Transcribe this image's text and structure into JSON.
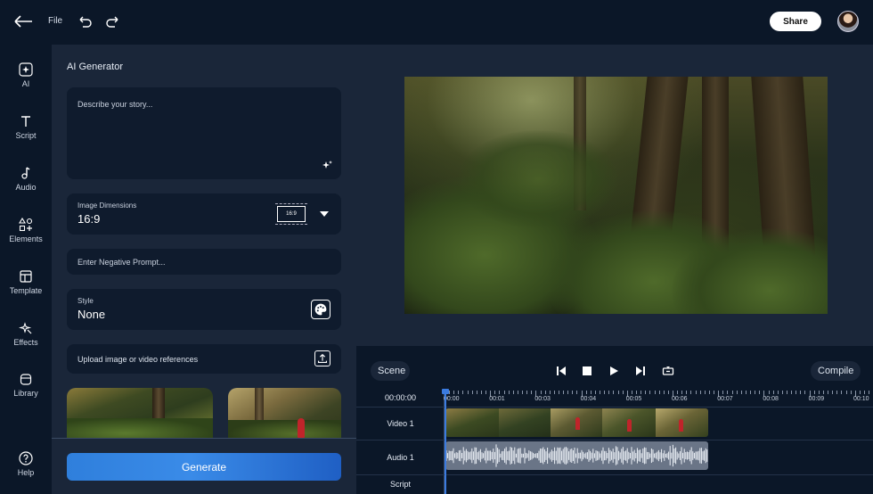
{
  "topbar": {
    "file_label": "File",
    "share_label": "Share"
  },
  "sidebar": {
    "items": [
      {
        "label": "AI",
        "icon": "ai-sparkle-icon"
      },
      {
        "label": "Script",
        "icon": "text-icon"
      },
      {
        "label": "Audio",
        "icon": "music-note-icon"
      },
      {
        "label": "Elements",
        "icon": "shapes-icon"
      },
      {
        "label": "Template",
        "icon": "template-icon"
      },
      {
        "label": "Effects",
        "icon": "effects-icon"
      },
      {
        "label": "Library",
        "icon": "library-icon"
      },
      {
        "label": "Help",
        "icon": "help-icon"
      }
    ]
  },
  "panel": {
    "title": "AI Generator",
    "story_placeholder": "Describe your story...",
    "dimensions_label": "Image Dimensions",
    "dimensions_value": "16:9",
    "dimensions_badge": "16:9",
    "negative_placeholder": "Enter Negative Prompt...",
    "style_label": "Style",
    "style_value": "None",
    "upload_label": "Upload image or video references",
    "generate_label": "Generate"
  },
  "controls": {
    "scene_label": "Scene",
    "compile_label": "Compile"
  },
  "timeline": {
    "current_time": "00:00:00",
    "ticks": [
      "00:00",
      "00:01",
      "00:03",
      "00:04",
      "00:05",
      "00:06",
      "00:07",
      "00:08",
      "00:09",
      "00:10"
    ],
    "tracks": [
      "Video 1",
      "Audio 1",
      "Script"
    ]
  },
  "colors": {
    "background": "#0b1728",
    "panel": "#1a2639",
    "input": "#0f1b2d",
    "accent": "#2f7fdc",
    "playhead": "#3b7be0"
  }
}
